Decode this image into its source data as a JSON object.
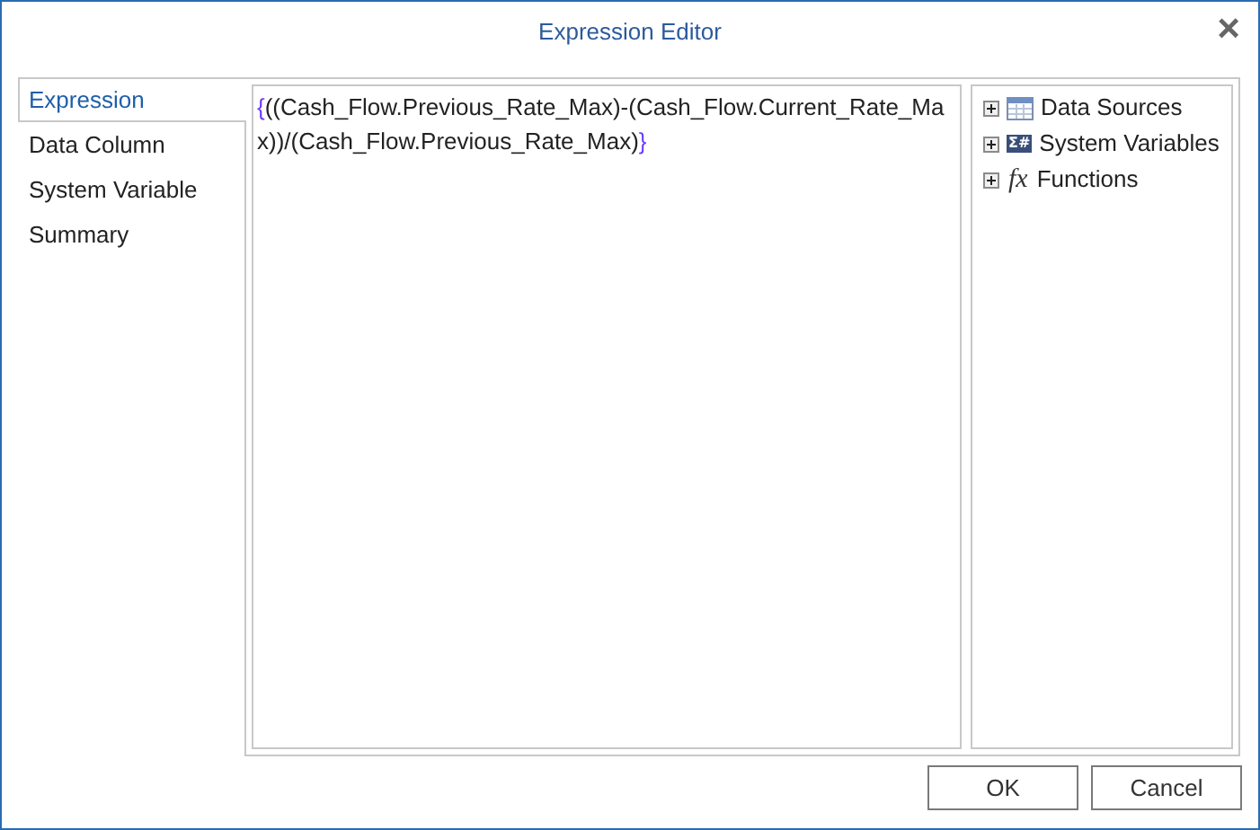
{
  "window": {
    "title": "Expression Editor",
    "close": "×"
  },
  "tabs": [
    {
      "label": "Expression",
      "selected": true
    },
    {
      "label": "Data Column",
      "selected": false
    },
    {
      "label": "System Variable",
      "selected": false
    },
    {
      "label": "Summary",
      "selected": false
    }
  ],
  "expression": {
    "value": "{((Cash_Flow.Previous_Rate_Max)-(Cash_Flow.Current_Rate_Max))/(Cash_Flow.Previous_Rate_Max)}"
  },
  "tree": [
    {
      "kind": "table",
      "label": "Data Sources",
      "expanded": false
    },
    {
      "kind": "variables",
      "icon_text": "Σ#",
      "label": "System Variables",
      "expanded": false
    },
    {
      "kind": "function",
      "icon_text": "fx",
      "label": "Functions",
      "expanded": false
    }
  ],
  "buttons": [
    "OK",
    "Cancel"
  ]
}
